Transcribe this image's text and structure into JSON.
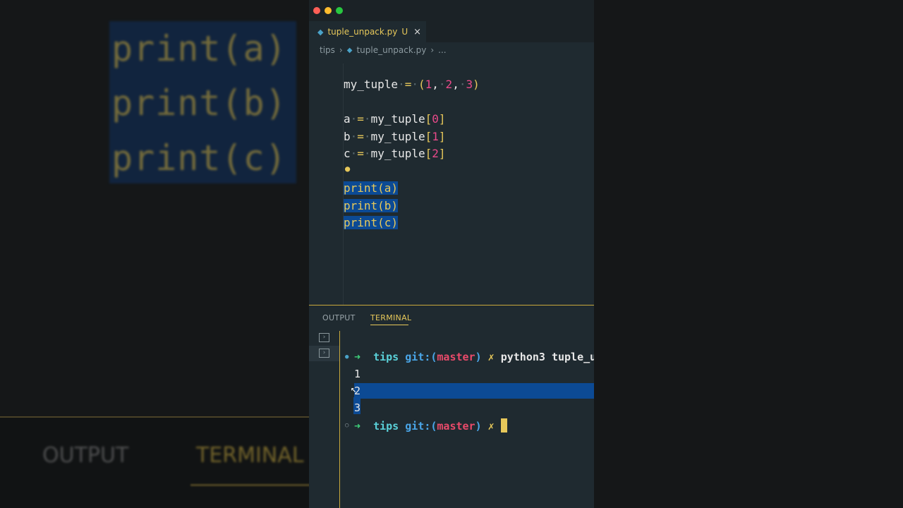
{
  "window": {
    "traffic_lights": [
      "#ff5f57",
      "#febc2e",
      "#28c840"
    ]
  },
  "tab": {
    "icon": "python-icon",
    "filename": "tuple_unpack.py",
    "modified_marker": "U",
    "close_glyph": "×"
  },
  "breadcrumb": {
    "folder": "tips",
    "file": "tuple_unpack.py",
    "more": "..."
  },
  "code": {
    "line1": {
      "name": "my_tuple",
      "op": "=",
      "open": "(",
      "v1": "1",
      "v2": "2",
      "v3": "3",
      "close": ")"
    },
    "line_a": {
      "var": "a",
      "op": "=",
      "rhs": "my_tuple",
      "ob": "[",
      "idx": "0",
      "cb": "]"
    },
    "line_b": {
      "var": "b",
      "op": "=",
      "rhs": "my_tuple",
      "ob": "[",
      "idx": "1",
      "cb": "]"
    },
    "line_c": {
      "var": "c",
      "op": "=",
      "rhs": "my_tuple",
      "ob": "[",
      "idx": "2",
      "cb": "]"
    },
    "print_a": "print(a)",
    "print_b": "print(b)",
    "print_c": "print(c)"
  },
  "panel": {
    "tabs": [
      "OUTPUT",
      "TERMINAL"
    ],
    "active_tab": "TERMINAL"
  },
  "terminal": {
    "prompt_arrow": "➜",
    "dir": "tips",
    "git_label": "git:(",
    "branch": "master",
    "git_close": ")",
    "dirty": "✗",
    "command": "python3 tuple_u",
    "output": [
      "1",
      "2",
      "3"
    ]
  },
  "background": {
    "zoom_lines": [
      "print(a)",
      "print(b)",
      "print(c)"
    ],
    "zoom_tabs": [
      "OUTPUT",
      "TERMINAL"
    ]
  }
}
